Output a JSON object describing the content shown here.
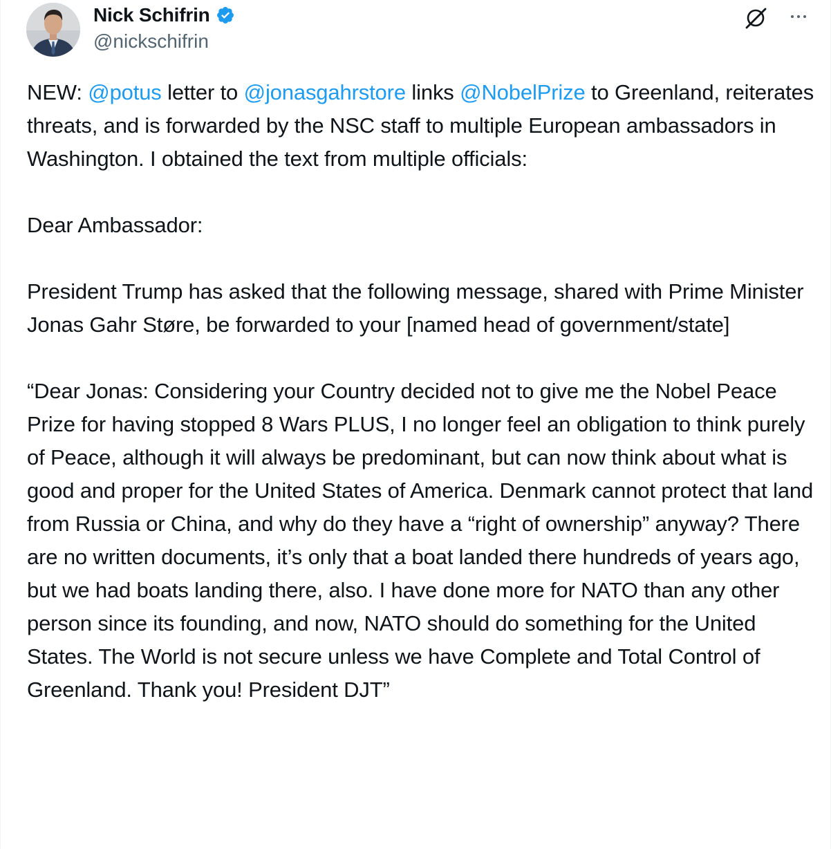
{
  "author": {
    "display_name": "Nick Schifrin",
    "handle": "@nickschifrin",
    "verified_icon": "verified-badge-icon",
    "colors": {
      "verified": "#1d9bf0",
      "handle": "#536471",
      "link": "#1d9bf0"
    }
  },
  "actions": {
    "grok_icon": "grok-icon",
    "more_icon": "more-dots-icon"
  },
  "tweet": {
    "intro": {
      "prefix": "NEW: ",
      "mention1": "@potus",
      "mid1": " letter to ",
      "mention2": "@jonasgahrstore",
      "mid2": " links ",
      "mention3": "@NobelPrize",
      "rest": " to Greenland, reiterates threats, and is forwarded by the NSC staff to multiple European ambassadors in Washington. I obtained the text from multiple officials:"
    },
    "salutation": "Dear Ambassador:",
    "paragraph2": "President Trump has asked that the following message, shared with Prime Minister Jonas Gahr Støre, be forwarded to your [named head of government/state]",
    "letter": "“Dear Jonas: Considering your Country decided not to give me the Nobel Peace Prize for having stopped 8 Wars PLUS, I no longer feel an obligation to think purely of Peace, although it will always be predominant, but can now think about what is good and proper for the United States of America. Denmark cannot protect that land from Russia or China, and why do they have a “right of ownership” anyway? There are no written documents, it’s only that a boat landed there hundreds of years ago, but we had boats landing there, also. I have done more for NATO than any other person since its founding, and now, NATO should do something for the United States. The World is not secure unless we have Complete and Total Control of Greenland. Thank you! President DJT”"
  }
}
